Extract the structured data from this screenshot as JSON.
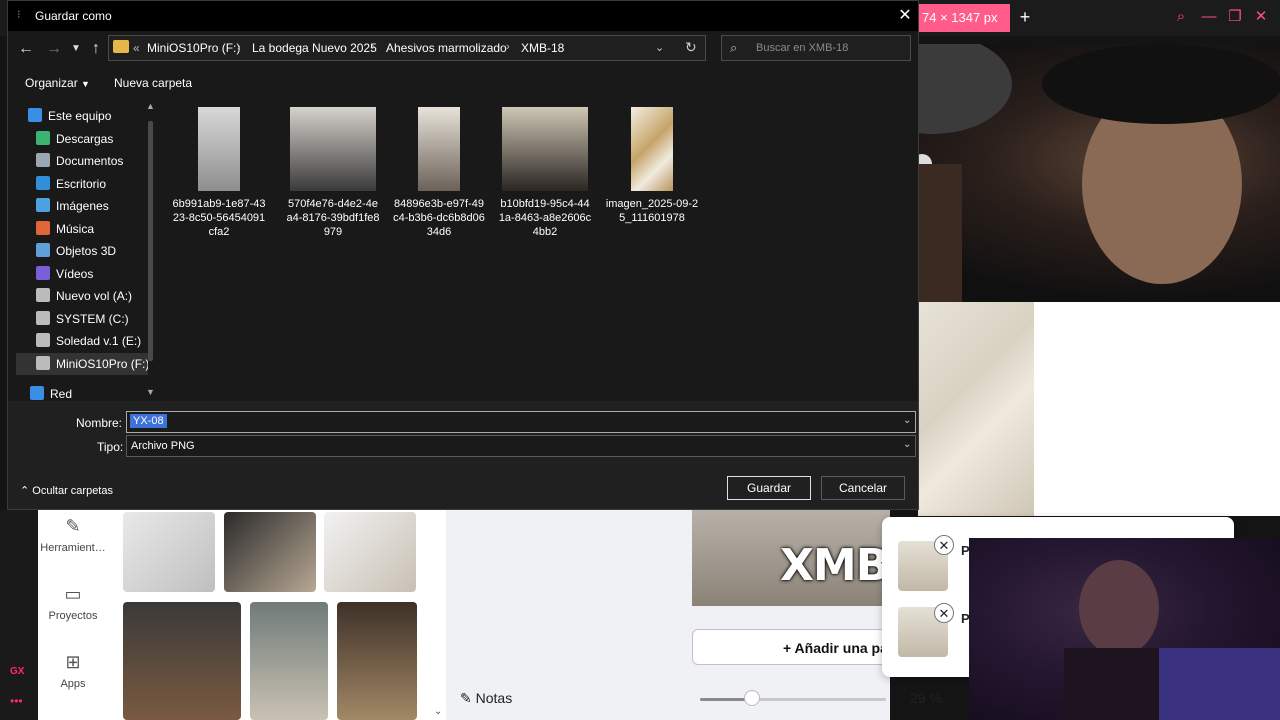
{
  "background_app": {
    "tab_label": "74 × 1347 px",
    "left_rail": {
      "brand": "GX",
      "more": "•••"
    },
    "side_buttons": [
      {
        "label": "Herramient…",
        "icon": "pencil-icon"
      },
      {
        "label": "Proyectos",
        "icon": "folder-icon"
      },
      {
        "label": "Apps",
        "icon": "apps-grid-icon"
      }
    ],
    "page_text": "XMB",
    "add_page_label": "+ Añadir una pá",
    "notes_label": "Notas",
    "zoom": {
      "value": "29 %",
      "level_percent": 29
    },
    "popup_letters": [
      "P",
      "P"
    ]
  },
  "dialog": {
    "title": "Guardar como",
    "address": {
      "overflow": "«",
      "crumbs": [
        "MiniOS10Pro (F:)",
        "La bodega Nuevo 2025",
        "Ahesivos marmolizado",
        "XMB-18"
      ]
    },
    "search_placeholder": "Buscar en XMB-18",
    "toolbar": {
      "organize": "Organizar",
      "new_folder": "Nueva carpeta"
    },
    "nav_items": [
      {
        "label": "Este equipo",
        "color": "#3a8ee6"
      },
      {
        "label": "Descargas",
        "color": "#3cb371"
      },
      {
        "label": "Documentos",
        "color": "#9aa6b2"
      },
      {
        "label": "Escritorio",
        "color": "#2f8fd8"
      },
      {
        "label": "Imágenes",
        "color": "#4aa3e0"
      },
      {
        "label": "Música",
        "color": "#e0663a"
      },
      {
        "label": "Objetos 3D",
        "color": "#5fa0d8"
      },
      {
        "label": "Vídeos",
        "color": "#7b5fd8"
      },
      {
        "label": "Nuevo vol (A:)",
        "color": "#bbbbbb"
      },
      {
        "label": "SYSTEM (C:)",
        "color": "#bbbbbb"
      },
      {
        "label": "Soledad v.1 (E:)",
        "color": "#bbbbbb"
      },
      {
        "label": "MiniOS10Pro (F:)",
        "color": "#bbbbbb"
      },
      {
        "label": "Red",
        "color": "#3a8ee6"
      }
    ],
    "files": [
      {
        "name": "6b991ab9-1e87-4323-8c50-56454091cfa2"
      },
      {
        "name": "570f4e76-d4e2-4ea4-8176-39bdf1fe8979"
      },
      {
        "name": "84896e3b-e97f-49c4-b3b6-dc6b8d0634d6"
      },
      {
        "name": "b10bfd19-95c4-441a-8463-a8e2606c4bb2"
      },
      {
        "name": "imagen_2025-09-25_111601978"
      }
    ],
    "filename_label": "Nombre:",
    "filename_value": "YX-08",
    "filetype_label": "Tipo:",
    "filetype_value": "Archivo PNG",
    "hide_folders": "Ocultar carpetas",
    "save_label": "Guardar",
    "cancel_label": "Cancelar"
  }
}
